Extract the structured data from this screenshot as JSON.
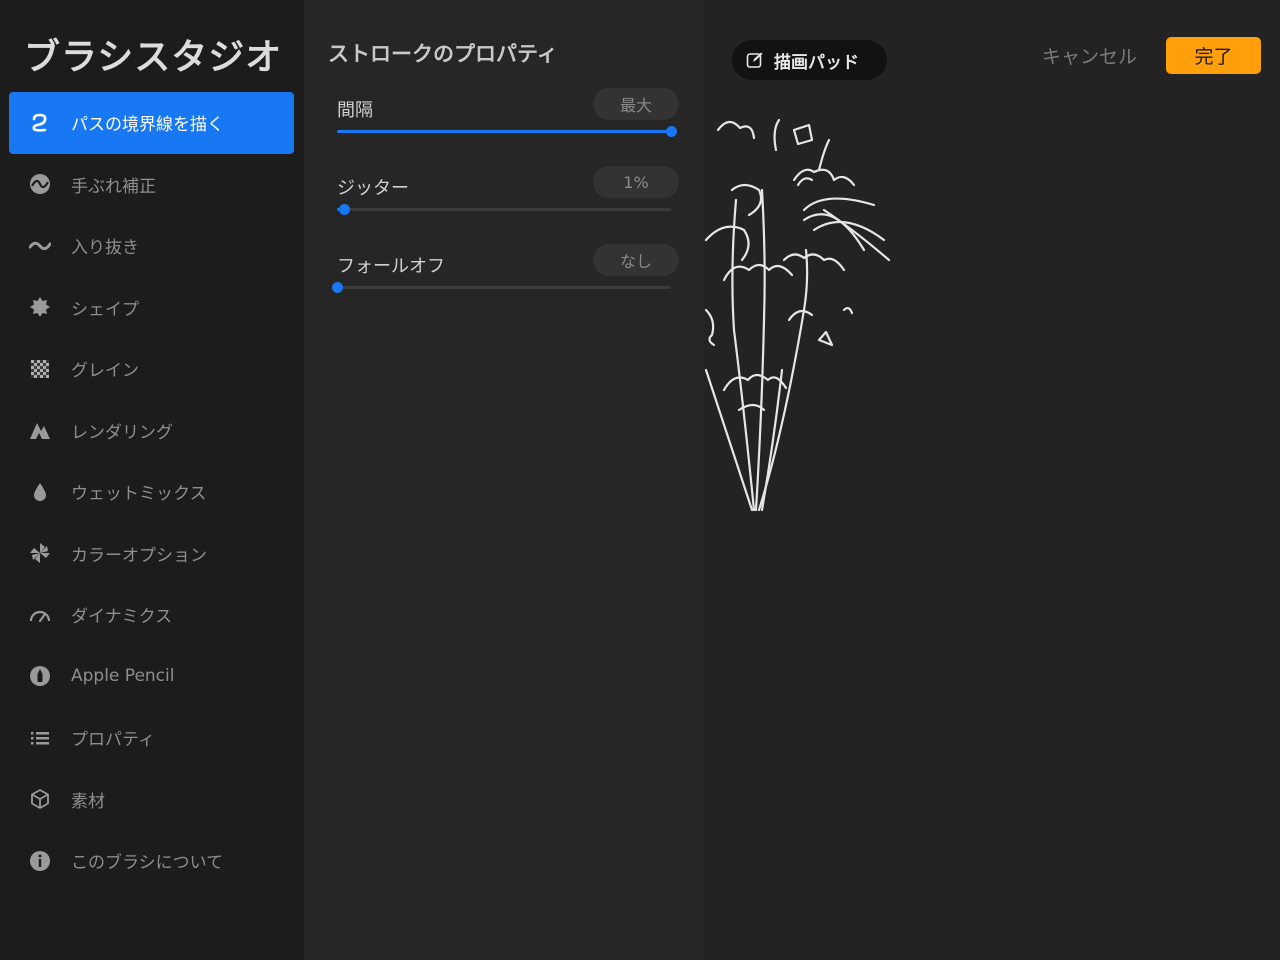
{
  "app_title": "ブラシスタジオ",
  "sidebar": {
    "items": [
      {
        "label": "パスの境界線を描く",
        "icon": "stroke-path-icon",
        "active": true
      },
      {
        "label": "手ぶれ補正",
        "icon": "stabilization-icon",
        "active": false
      },
      {
        "label": "入り抜き",
        "icon": "taper-icon",
        "active": false
      },
      {
        "label": "シェイプ",
        "icon": "shape-icon",
        "active": false
      },
      {
        "label": "グレイン",
        "icon": "grain-icon",
        "active": false
      },
      {
        "label": "レンダリング",
        "icon": "rendering-icon",
        "active": false
      },
      {
        "label": "ウェットミックス",
        "icon": "wet-mix-icon",
        "active": false
      },
      {
        "label": "カラーオプション",
        "icon": "color-options-icon",
        "active": false
      },
      {
        "label": "ダイナミクス",
        "icon": "dynamics-icon",
        "active": false
      },
      {
        "label": "Apple Pencil",
        "icon": "apple-pencil-icon",
        "active": false
      },
      {
        "label": "プロパティ",
        "icon": "properties-icon",
        "active": false
      },
      {
        "label": "素材",
        "icon": "materials-icon",
        "active": false
      },
      {
        "label": "このブラシについて",
        "icon": "about-icon",
        "active": false
      }
    ]
  },
  "panel": {
    "title": "ストロークのプロパティ",
    "settings": [
      {
        "label": "間隔",
        "value": "最大",
        "level": 1.0
      },
      {
        "label": "ジッター",
        "value": "1%",
        "level": 0.02
      },
      {
        "label": "フォールオフ",
        "value": "なし",
        "level": 0.0
      }
    ]
  },
  "pad": {
    "badge": "描画パッド",
    "cancel": "キャンセル",
    "done": "完了"
  },
  "colors": {
    "accent": "#1877f2",
    "done": "#ff9f0a"
  }
}
